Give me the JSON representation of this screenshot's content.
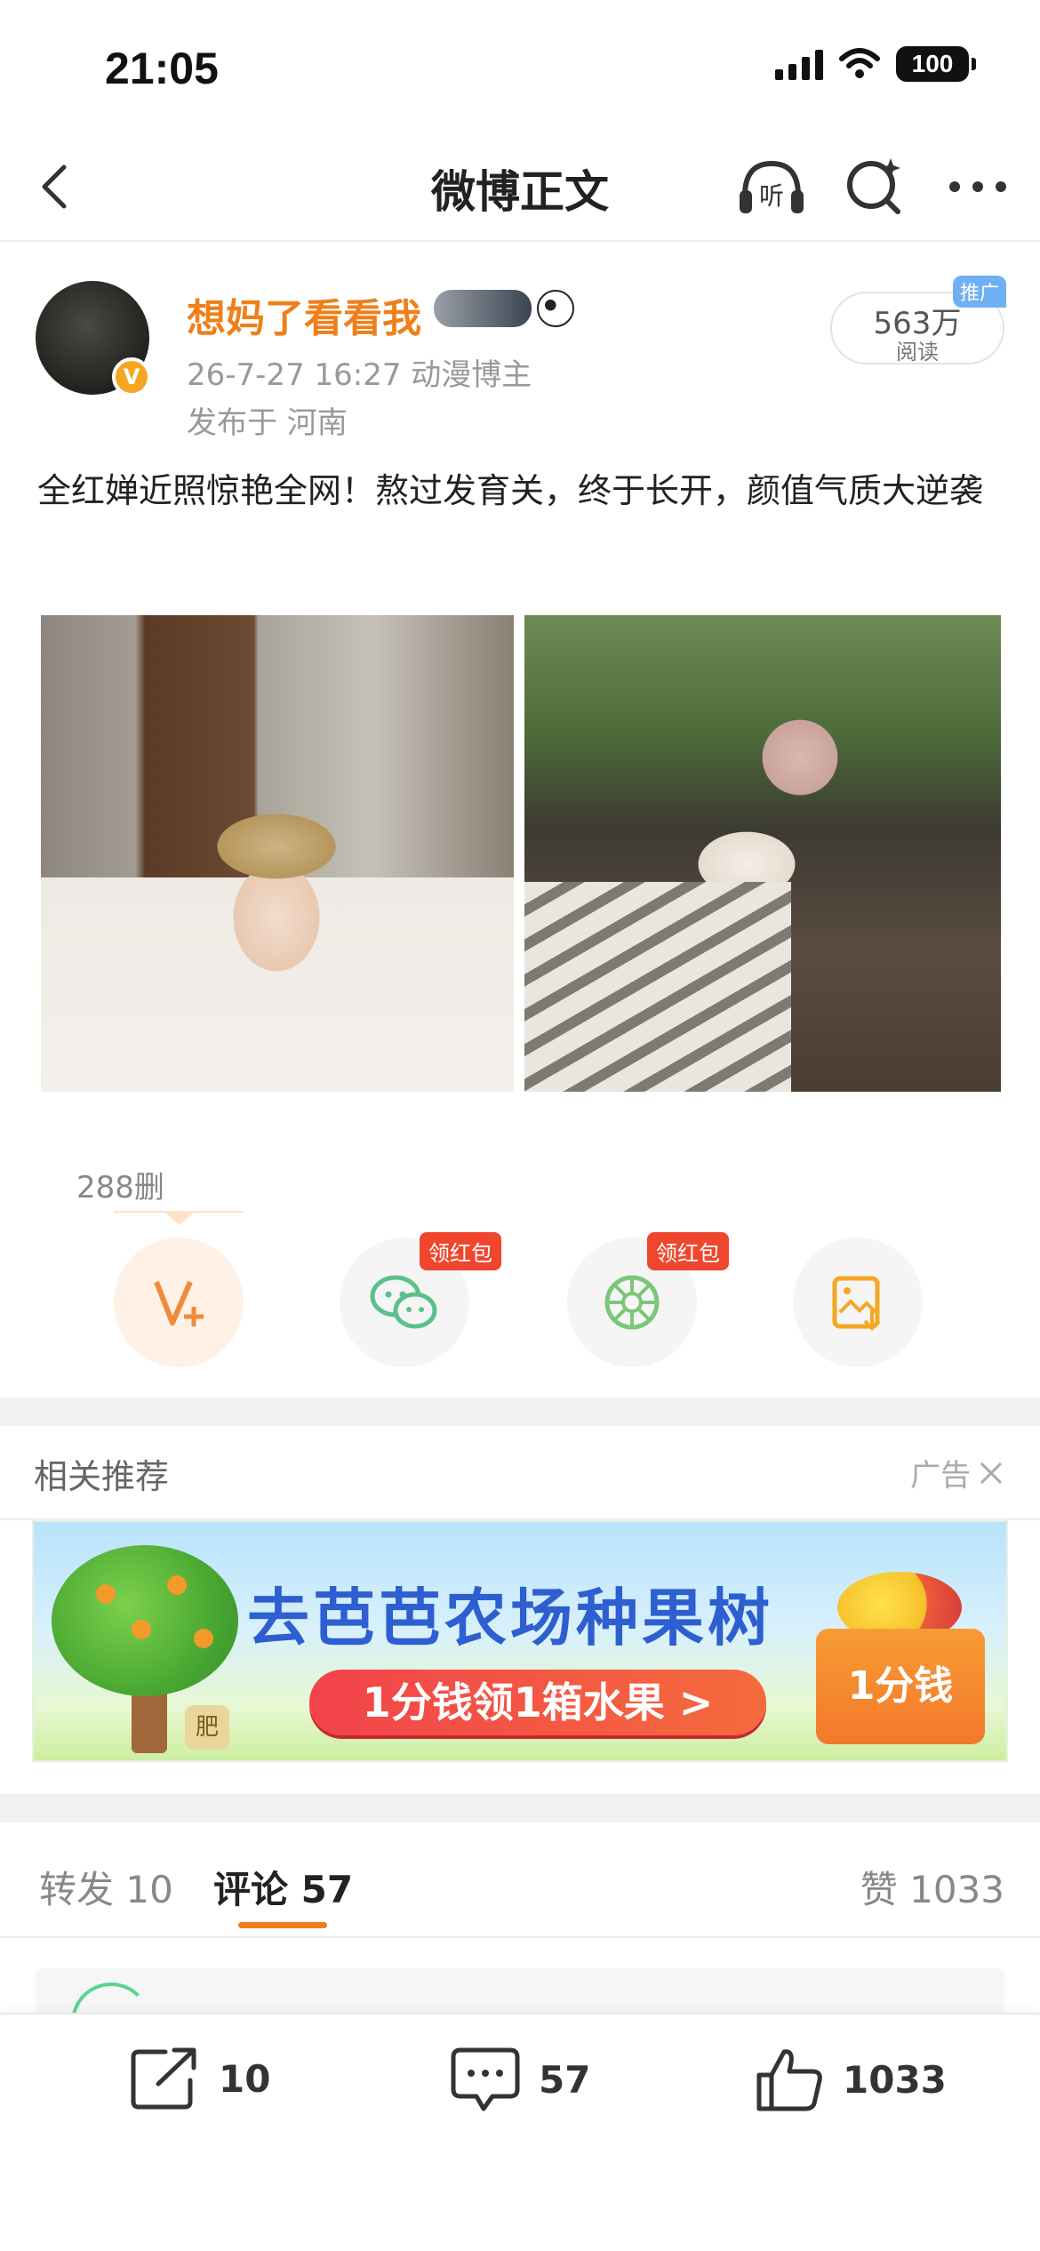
{
  "status": {
    "time": "21:05",
    "battery": "100"
  },
  "nav": {
    "title": "微博正文",
    "listen_label": "听"
  },
  "author": {
    "name": "想妈了看看我",
    "meta": "26-7-27 16:27  动漫博主",
    "location": "发布于 河南",
    "verified_badge": "V",
    "read_count": "563万",
    "read_label": "阅读",
    "promo_tag": "推广"
  },
  "post": {
    "text": "全红婵近照惊艳全网！熬过发育关，终于长开，颜值气质大逆袭"
  },
  "share": {
    "forward_count": "288删",
    "items": [
      {
        "icon": "vplus-icon",
        "tag": ""
      },
      {
        "icon": "wechat-icon",
        "tag": "领红包"
      },
      {
        "icon": "moments-icon",
        "tag": "领红包"
      },
      {
        "icon": "save-image-icon",
        "tag": ""
      }
    ]
  },
  "recommend": {
    "title": "相关推荐",
    "ad_label": "广告",
    "banner": {
      "headline": "去芭芭农场种果树",
      "button": "1分钱领1箱水果 >",
      "box_label": "1分钱",
      "tree_label": "肥"
    }
  },
  "tabs": {
    "repost_label": "转发",
    "repost_count": "10",
    "comment_label": "评论",
    "comment_count": "57",
    "like_label": "赞",
    "like_count": "1033"
  },
  "bottom_bar": {
    "repost": "10",
    "comment": "57",
    "like": "1033"
  },
  "colors": {
    "accent": "#f07f1a",
    "tag_red": "#f0462d",
    "wechat_green": "#5cc08b",
    "save_orange": "#f5a623"
  }
}
